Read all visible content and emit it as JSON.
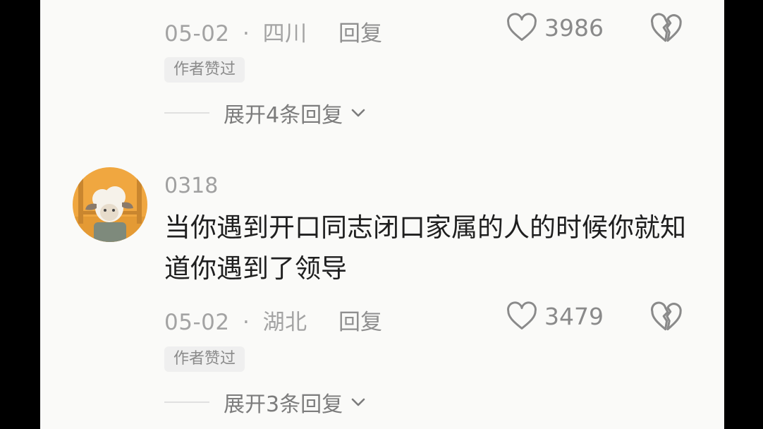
{
  "comments": [
    {
      "date": "05-02",
      "sep": "·",
      "location": "四川",
      "reply_label": "回复",
      "likes": "3986",
      "author_tag": "作者赞过",
      "expand_label": "展开4条回复"
    },
    {
      "username": "0318",
      "text": "当你遇到开口同志闭口家属的人的时候你就知道你遇到了领导",
      "date": "05-02",
      "sep": "·",
      "location": "湖北",
      "reply_label": "回复",
      "likes": "3479",
      "author_tag": "作者赞过",
      "expand_label": "展开3条回复"
    }
  ],
  "colors": {
    "background": "#fafaf8",
    "side_bars": "#000000",
    "meta_text": "#a3a3a3",
    "content_text": "#1f1f1f",
    "tag_bg": "#efefef",
    "avatar_bg": "#f0a740"
  },
  "icons": {
    "like": "heart-outline-icon",
    "dislike": "broken-heart-icon",
    "expand": "chevron-down-icon"
  }
}
